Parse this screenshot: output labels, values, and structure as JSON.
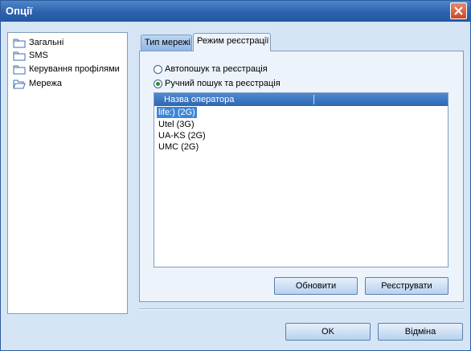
{
  "window": {
    "title": "Опції"
  },
  "sidebar": {
    "items": [
      {
        "label": "Загальні"
      },
      {
        "label": "SMS"
      },
      {
        "label": "Керування профілями"
      },
      {
        "label": "Мережа"
      }
    ]
  },
  "tabs": [
    {
      "label": "Тип мережі",
      "active": false
    },
    {
      "label": "Режим реєстрації",
      "active": true
    }
  ],
  "registration": {
    "options": [
      {
        "label": "Автопошук та реєстрація",
        "checked": false
      },
      {
        "label": "Ручний пошук та реєстрація",
        "checked": true
      }
    ],
    "table": {
      "column_header": "Назва оператора",
      "rows": [
        "life:) (2G)",
        "Utel (3G)",
        "UA-KS (2G)",
        "UMC (2G)"
      ],
      "selected_index": 0
    },
    "refresh_label": "Обновити",
    "register_label": "Реєструвати"
  },
  "footer": {
    "ok_label": "OK",
    "cancel_label": "Відміна"
  },
  "colors": {
    "titlebar": "#2c62ad",
    "background": "#d5e5f5",
    "selection": "#3d86d6"
  }
}
